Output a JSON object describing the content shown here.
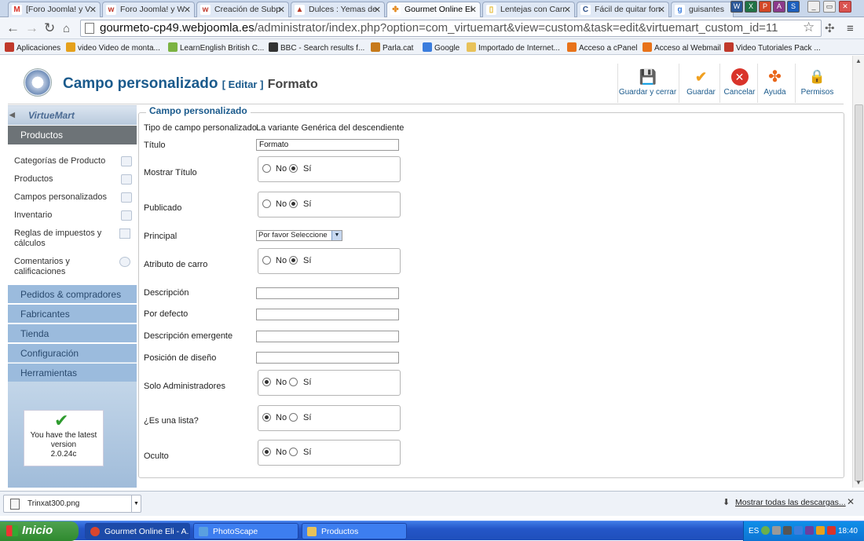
{
  "browser": {
    "tabs": [
      {
        "label": "[Foro Joomla! y V",
        "icon": "gmail-icon",
        "color": "#d93025",
        "glyph": "M"
      },
      {
        "label": "Foro Joomla! y W",
        "icon": "w-icon",
        "color": "#c0392b",
        "glyph": "w"
      },
      {
        "label": "Creación de Subp",
        "icon": "w-icon",
        "color": "#c0392b",
        "glyph": "w"
      },
      {
        "label": "Dulces : Yemas de",
        "icon": "hat-icon",
        "color": "#b53a2a",
        "glyph": "▲"
      },
      {
        "label": "Gourmet Online El",
        "icon": "joomla-icon",
        "color": "#e48a1f",
        "glyph": "✤"
      },
      {
        "label": "Lentejas con Carr",
        "icon": "bookmark-icon",
        "color": "#e0b21a",
        "glyph": "▯"
      },
      {
        "label": "Fácil de quitar fon",
        "icon": "c-icon",
        "color": "#2b4f8a",
        "glyph": "C"
      },
      {
        "label": "guisantes",
        "icon": "google-icon",
        "color": "#3b7ddd",
        "glyph": "g"
      }
    ],
    "tab_close": "✕",
    "url_host": "gourmeto-cp49.webjoomla.es",
    "url_path": "/administrator/index.php?option=com_virtuemart&view=custom&task=edit&virtuemart_custom_id=11",
    "bookmarks": [
      {
        "label": "Aplicaciones",
        "icon": "apps-icon",
        "color": "#c0392b"
      },
      {
        "label": "video Video de monta...",
        "icon": "apps-colored-icon",
        "color": "#e5a11c"
      },
      {
        "label": "LearnEnglish British C...",
        "icon": "apps-colored-icon",
        "color": "#7cb342"
      },
      {
        "label": "BBC - Search results f...",
        "icon": "bbc-icon",
        "color": "#333333"
      },
      {
        "label": "Parla.cat",
        "icon": "parla-icon",
        "color": "#c77a1a"
      },
      {
        "label": "Google",
        "icon": "google-icon",
        "color": "#3b7ddd"
      },
      {
        "label": "Importado de Internet...",
        "icon": "folder-icon",
        "color": "#e8c25a"
      },
      {
        "label": "Acceso a cPanel",
        "icon": "cpanel-icon",
        "color": "#e8731a"
      },
      {
        "label": "Acceso al Webmail",
        "icon": "cpanel-icon",
        "color": "#e8731a"
      },
      {
        "label": "Video Tutoriales Pack ...",
        "icon": "w-icon",
        "color": "#c0392b"
      }
    ]
  },
  "header": {
    "title": "Campo personalizado",
    "edit_label": "[ Editar ]",
    "subject": "Formato"
  },
  "toolbar": {
    "save_close": "Guardar y cerrar",
    "save": "Guardar",
    "cancel": "Cancelar",
    "help": "Ayuda",
    "permissions": "Permisos"
  },
  "sidebar": {
    "logo": "VirtueMart",
    "sections": [
      {
        "label": "Productos"
      },
      {
        "label": "Pedidos & compradores"
      },
      {
        "label": "Fabricantes"
      },
      {
        "label": "Tienda"
      },
      {
        "label": "Configuración"
      },
      {
        "label": "Herramientas"
      }
    ],
    "items": [
      {
        "label": "Categorías de Producto"
      },
      {
        "label": "Productos"
      },
      {
        "label": "Campos personalizados"
      },
      {
        "label": "Inventario"
      },
      {
        "label": "Reglas de impuestos y cálculos"
      },
      {
        "label": "Comentarios y calificaciones"
      }
    ],
    "update_text": "You have the latest version",
    "version": "2.0.24c"
  },
  "form": {
    "legend": "Campo personalizado",
    "type_label": "Tipo de campo personalizado",
    "type_value": "La variante Genérica del descendiente",
    "title_label": "Título",
    "title_value": "Formato",
    "show_title_label": "Mostrar Título",
    "published_label": "Publicado",
    "parent_label": "Principal",
    "parent_value": "Por favor Seleccione",
    "cart_attr_label": "Atributo de carro",
    "description_label": "Descripción",
    "default_label": "Por defecto",
    "tooltip_label": "Descripción emergente",
    "layout_pos_label": "Posición de diseño",
    "admin_only_label": "Solo Administradores",
    "is_list_label": "¿Es una lista?",
    "hidden_label": "Oculto",
    "no": "No",
    "yes": "Sí",
    "radios": {
      "show_title": "yes",
      "published": "yes",
      "cart_attr": "yes",
      "admin_only": "no",
      "is_list": "no",
      "hidden": "no"
    }
  },
  "downloads": {
    "file": "Trinxat300.png",
    "show_all": "Mostrar todas las descargas...",
    "close": "✕"
  },
  "taskbar": {
    "start": "Inicio",
    "tasks": [
      {
        "label": "Gourmet Online Eli - A...",
        "icon": "chrome-icon",
        "color": "#d9462f"
      },
      {
        "label": "PhotoScape",
        "icon": "photoscape-icon",
        "color": "#5aa0e0"
      },
      {
        "label": "Productos",
        "icon": "folder-icon",
        "color": "#e8c25a"
      }
    ],
    "lang": "ES",
    "time": "18:40"
  }
}
